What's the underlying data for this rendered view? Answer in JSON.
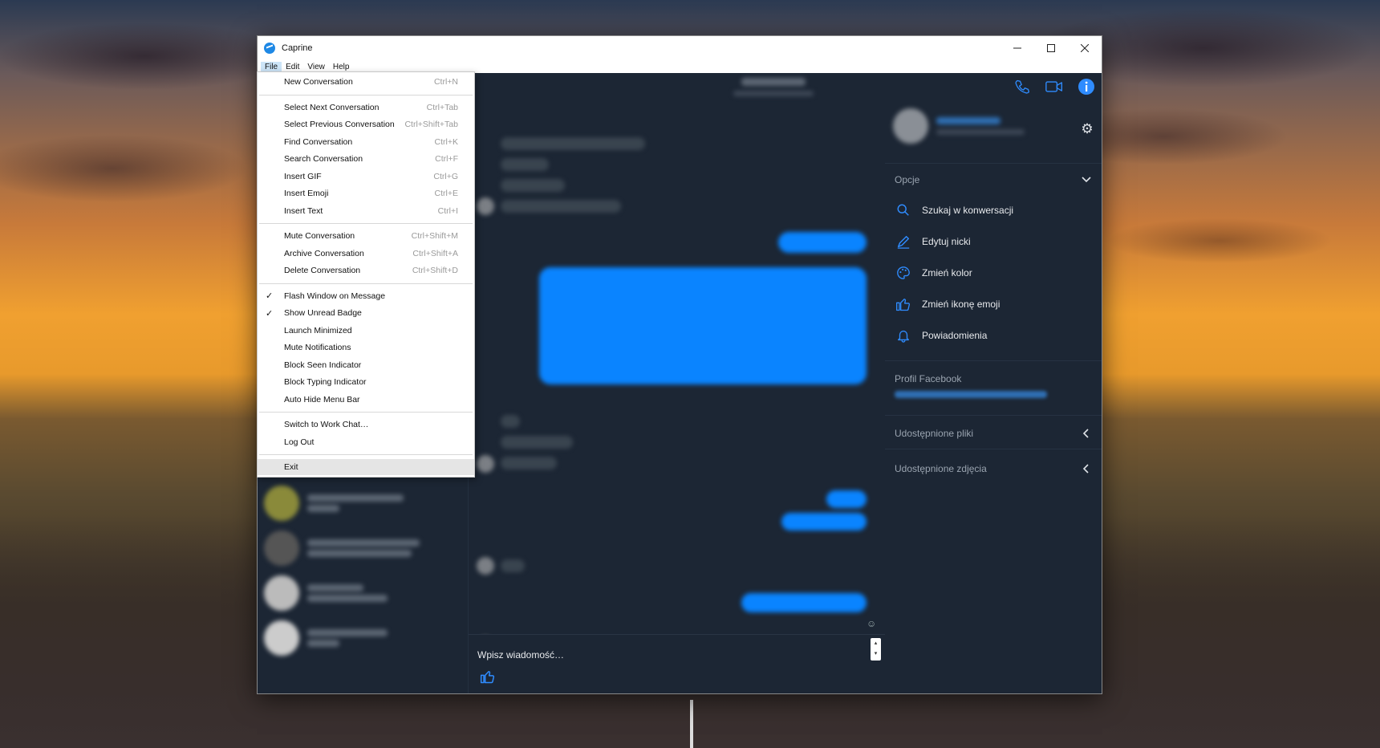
{
  "window": {
    "title": "Caprine",
    "controls": [
      "minimize",
      "maximize",
      "close"
    ]
  },
  "menubar": {
    "items": [
      "File",
      "Edit",
      "View",
      "Help"
    ],
    "active": "File"
  },
  "file_menu": {
    "groups": [
      [
        {
          "label": "New Conversation",
          "shortcut": "Ctrl+N"
        }
      ],
      [
        {
          "label": "Select Next Conversation",
          "shortcut": "Ctrl+Tab"
        },
        {
          "label": "Select Previous Conversation",
          "shortcut": "Ctrl+Shift+Tab"
        },
        {
          "label": "Find Conversation",
          "shortcut": "Ctrl+K"
        },
        {
          "label": "Search Conversation",
          "shortcut": "Ctrl+F"
        },
        {
          "label": "Insert GIF",
          "shortcut": "Ctrl+G"
        },
        {
          "label": "Insert Emoji",
          "shortcut": "Ctrl+E"
        },
        {
          "label": "Insert Text",
          "shortcut": "Ctrl+I"
        }
      ],
      [
        {
          "label": "Mute Conversation",
          "shortcut": "Ctrl+Shift+M"
        },
        {
          "label": "Archive Conversation",
          "shortcut": "Ctrl+Shift+A"
        },
        {
          "label": "Delete Conversation",
          "shortcut": "Ctrl+Shift+D"
        }
      ],
      [
        {
          "label": "Flash Window on Message",
          "checked": true
        },
        {
          "label": "Show Unread Badge",
          "checked": true
        },
        {
          "label": "Launch Minimized",
          "checked": false
        },
        {
          "label": "Mute Notifications",
          "checked": false
        },
        {
          "label": "Block Seen Indicator",
          "checked": false
        },
        {
          "label": "Block Typing Indicator",
          "checked": false
        },
        {
          "label": "Auto Hide Menu Bar",
          "checked": false
        }
      ],
      [
        {
          "label": "Switch to Work Chat…"
        },
        {
          "label": "Log Out"
        }
      ],
      [
        {
          "label": "Exit",
          "highlighted": true
        }
      ]
    ]
  },
  "composer": {
    "placeholder": "Wpisz wiadomość…"
  },
  "right_panel": {
    "options_title": "Opcje",
    "options": [
      {
        "label": "Szukaj w konwersacji",
        "icon": "search-icon"
      },
      {
        "label": "Edytuj nicki",
        "icon": "pencil-icon"
      },
      {
        "label": "Zmień kolor",
        "icon": "palette-icon"
      },
      {
        "label": "Zmień ikonę emoji",
        "icon": "thumbs-up-icon"
      },
      {
        "label": "Powiadomienia",
        "icon": "bell-icon"
      }
    ],
    "facebook_profile_title": "Profil Facebook",
    "shared_files": "Udostępnione pliki",
    "shared_photos": "Udostępnione zdjęcia"
  },
  "colors": {
    "accent": "#0a84ff",
    "panel_bg": "#1c2634",
    "icon_blue": "#2f8cff"
  }
}
